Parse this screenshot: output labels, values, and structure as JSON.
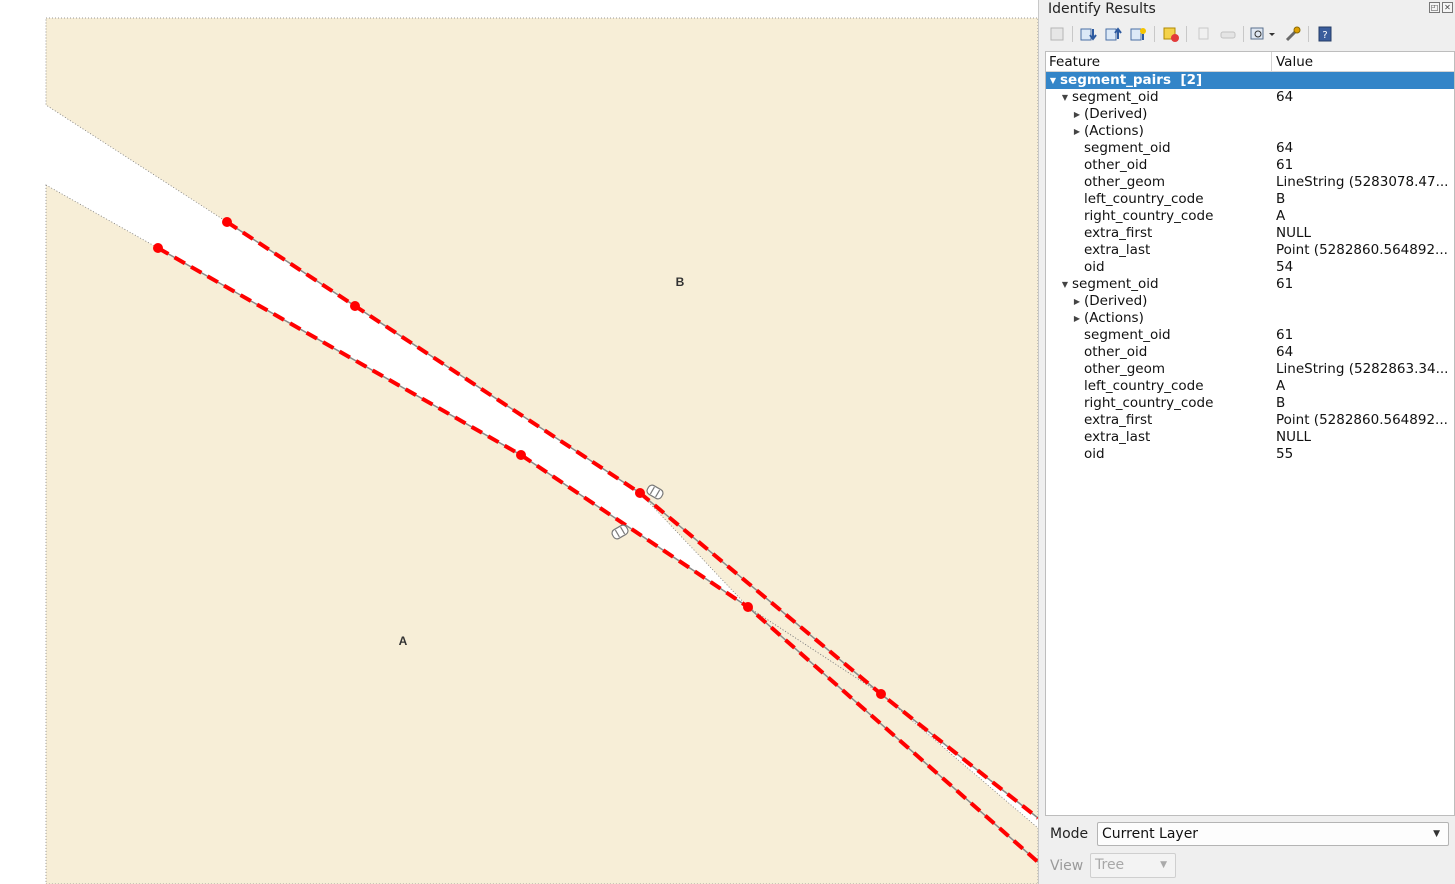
{
  "map": {
    "labels": [
      {
        "name": "country-label-b",
        "text": "B"
      },
      {
        "name": "country-label-a",
        "text": "A"
      }
    ],
    "colors": {
      "polygon_fill": "#f7eed7",
      "segment_line": "#ff0000",
      "vertex": "#ff0000",
      "background": "#ffffff"
    }
  },
  "panel": {
    "title": "Identify Results",
    "toolbar_icons": [
      "expand-tree-icon",
      "expand-all-icon",
      "collapse-all-icon",
      "expand-new-icon",
      "clear-results-icon",
      "copy-feature-icon",
      "print-icon",
      "identify-mode-icon",
      "settings-icon",
      "help-icon"
    ],
    "header": {
      "feature": "Feature",
      "value": "Value"
    },
    "layer": {
      "label": "segment_pairs",
      "count": "[2]"
    },
    "features": [
      {
        "label": "segment_oid",
        "value": "64",
        "derived": "(Derived)",
        "actions": "(Actions)",
        "attributes": [
          {
            "field": "segment_oid",
            "value": "64"
          },
          {
            "field": "other_oid",
            "value": "61"
          },
          {
            "field": "other_geom",
            "value": "LineString (5283078.47..."
          },
          {
            "field": "left_country_code",
            "value": "B"
          },
          {
            "field": "right_country_code",
            "value": "A"
          },
          {
            "field": "extra_first",
            "value": "NULL"
          },
          {
            "field": "extra_last",
            "value": "Point (5282860.564892..."
          },
          {
            "field": "oid",
            "value": "54"
          }
        ]
      },
      {
        "label": "segment_oid",
        "value": "61",
        "derived": "(Derived)",
        "actions": "(Actions)",
        "attributes": [
          {
            "field": "segment_oid",
            "value": "61"
          },
          {
            "field": "other_oid",
            "value": "64"
          },
          {
            "field": "other_geom",
            "value": "LineString (5282863.34..."
          },
          {
            "field": "left_country_code",
            "value": "A"
          },
          {
            "field": "right_country_code",
            "value": "B"
          },
          {
            "field": "extra_first",
            "value": "Point (5282860.564892..."
          },
          {
            "field": "extra_last",
            "value": "NULL"
          },
          {
            "field": "oid",
            "value": "55"
          }
        ]
      }
    ],
    "mode": {
      "label": "Mode",
      "selected": "Current Layer"
    },
    "view": {
      "label": "View",
      "selected": "Tree"
    },
    "colors": {
      "selection": "#3385c8"
    }
  }
}
